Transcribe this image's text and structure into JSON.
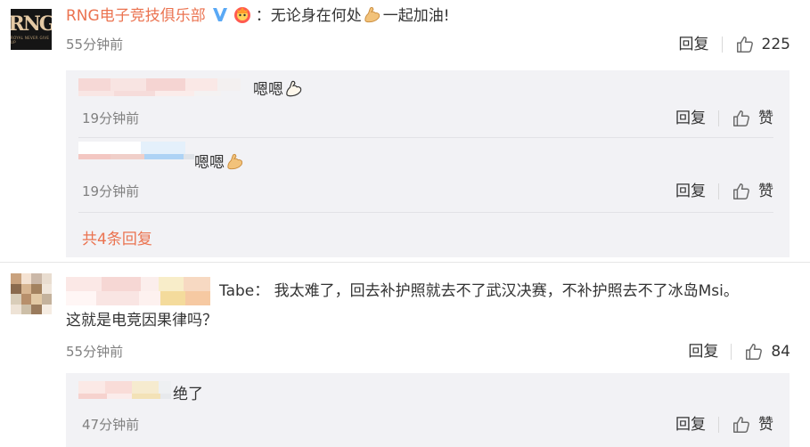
{
  "comments": [
    {
      "username": "RNG电子竞技俱乐部",
      "separator": "：",
      "text_before": "无论身在何处",
      "text_after": "一起加油!",
      "time": "55分钟前",
      "reply_label": "回复",
      "likes": "225",
      "avatar_text": "RNG",
      "avatar_subtext": "ROYAL NEVER GIVE UP",
      "replies": [
        {
          "text": "嗯嗯",
          "time": "19分钟前",
          "reply_label": "回复",
          "like_label": "赞"
        },
        {
          "text": "嗯嗯",
          "time": "19分钟前",
          "reply_label": "回复",
          "like_label": "赞"
        }
      ],
      "more_replies": "共4条回复"
    },
    {
      "text_line1": "Tabe： 我太难了，回去补护照就去不了武汉决赛，不补护照去不了冰岛Msi。",
      "text_line2": "这就是电竞因果律吗？",
      "time": "55分钟前",
      "reply_label": "回复",
      "likes": "84",
      "replies": [
        {
          "text": "绝了",
          "time": "47分钟前",
          "reply_label": "回复",
          "like_label": "赞"
        }
      ]
    }
  ],
  "colors": {
    "username": "#eb7350",
    "link": "#eb7350",
    "meta": "#808080",
    "reply_bg": "#f2f2f5",
    "vip_blue": "#5aa9f5"
  }
}
